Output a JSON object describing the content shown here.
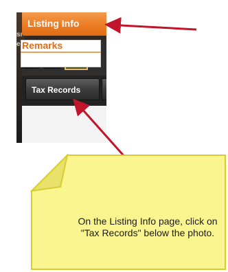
{
  "app": {
    "bg_text_partial": "sı\ne",
    "header_title": "Listing Info",
    "nav": {
      "first_icon": "double-chevron-left-icon",
      "prev_icon": "chevron-left-icon"
    },
    "photo_thumbnail": "house-photo",
    "tab_label": "Tax Records",
    "remarks_label": "Remarks"
  },
  "annotation": {
    "callout_text": "On the Listing Info page, click on \"Tax Records\" below the photo.",
    "arrow_color": "#c0152a",
    "note_fill": "#fbf58f",
    "note_border": "#d7cc35"
  },
  "colors": {
    "accent_orange": "#ec7d24",
    "dark_ui": "#232323"
  }
}
